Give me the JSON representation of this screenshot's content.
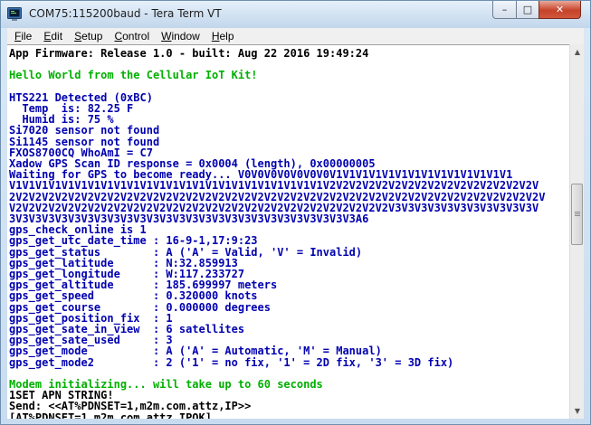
{
  "window": {
    "title": "COM75:115200baud - Tera Term VT",
    "buttons": {
      "minimize": "–",
      "maximize": "□",
      "close": "✕"
    },
    "icon": "tera-term-icon"
  },
  "menu": [
    {
      "label": "File",
      "key": "F",
      "rest": "ile"
    },
    {
      "label": "Edit",
      "key": "E",
      "rest": "dit"
    },
    {
      "label": "Setup",
      "key": "S",
      "rest": "etup"
    },
    {
      "label": "Control",
      "key": "C",
      "rest": "ontrol"
    },
    {
      "label": "Window",
      "key": "W",
      "rest": "indow"
    },
    {
      "label": "Help",
      "key": "H",
      "rest": "elp"
    }
  ],
  "colors": {
    "black": "#000000",
    "green": "#00b000",
    "blue": "#0000b0"
  },
  "terminal": {
    "lines": [
      {
        "text": "App Firmware: Release 1.0 - built: Aug 22 2016 19:49:24",
        "color": "black"
      },
      {
        "text": "",
        "color": "black"
      },
      {
        "text": "Hello World from the Cellular IoT Kit!",
        "color": "green"
      },
      {
        "text": "",
        "color": "black"
      },
      {
        "text": "HTS221 Detected (0xBC)",
        "color": "blue"
      },
      {
        "text": "  Temp  is: 82.25 F",
        "color": "blue"
      },
      {
        "text": "  Humid is: 75 %",
        "color": "blue"
      },
      {
        "text": "Si7020 sensor not found",
        "color": "blue"
      },
      {
        "text": "Si1145 sensor not found",
        "color": "blue"
      },
      {
        "text": "FXOS8700CQ WhoAmI = C7",
        "color": "blue"
      },
      {
        "text": "Xadow GPS Scan ID response = 0x0004 (length), 0x00000005",
        "color": "blue"
      },
      {
        "text": "Waiting for GPS to become ready... V0V0V0V0V0V0V0V1V1V1V1V1V1V1V1V1V1V1V1V1V1",
        "color": "blue"
      },
      {
        "text": "V1V1V1V1V1V1V1V1V1V1V1V1V1V1V1V1V1V1V1V1V1V1V1V1V2V2V2V2V2V2V2V2V2V2V2V2V2V2V2V2V",
        "color": "blue"
      },
      {
        "text": "2V2V2V2V2V2V2V2V2V2V2V2V2V2V2V2V2V2V2V2V2V2V2V2V2V2V2V2V2V2V2V2V2V2V2V2V2V2V2V2V2V",
        "color": "blue"
      },
      {
        "text": "V2V2V2V2V2V2V2V2V2V2V2V2V2V2V2V2V2V2V2V2V2V2V2V2V2V2V2V2V2V3V3V3V3V3V3V3V3V3V3V3V",
        "color": "blue"
      },
      {
        "text": "3V3V3V3V3V3V3V3V3V3V3V3V3V3V3V3V3V3V3V3V3V3V3V3V3V3V3A6",
        "color": "blue"
      },
      {
        "text": "gps_check_online is 1",
        "color": "blue"
      },
      {
        "text": "gps_get_utc_date_time : 16-9-1,17:9:23",
        "color": "blue"
      },
      {
        "text": "gps_get_status        : A ('A' = Valid, 'V' = Invalid)",
        "color": "blue"
      },
      {
        "text": "gps_get_latitude      : N:32.859913",
        "color": "blue"
      },
      {
        "text": "gps_get_longitude     : W:117.233727",
        "color": "blue"
      },
      {
        "text": "gps_get_altitude      : 185.699997 meters",
        "color": "blue"
      },
      {
        "text": "gps_get_speed         : 0.320000 knots",
        "color": "blue"
      },
      {
        "text": "gps_get_course        : 0.000000 degrees",
        "color": "blue"
      },
      {
        "text": "gps_get_position_fix  : 1",
        "color": "blue"
      },
      {
        "text": "gps_get_sate_in_view  : 6 satellites",
        "color": "blue"
      },
      {
        "text": "gps_get_sate_used     : 3",
        "color": "blue"
      },
      {
        "text": "gps_get_mode          : A ('A' = Automatic, 'M' = Manual)",
        "color": "blue"
      },
      {
        "text": "gps_get_mode2         : 2 ('1' = no fix, '1' = 2D fix, '3' = 3D fix)",
        "color": "blue"
      },
      {
        "text": "",
        "color": "black"
      },
      {
        "text": "Modem initializing... will take up to 60 seconds",
        "color": "green"
      },
      {
        "text": "1SET APN STRING!",
        "color": "black"
      },
      {
        "text": "Send: <<AT%PDNSET=1,m2m.com.attz,IP>>",
        "color": "black"
      },
      {
        "text": "[AT%PDNSET=1,m2m.com.attz,IPOK]",
        "color": "black"
      }
    ]
  }
}
